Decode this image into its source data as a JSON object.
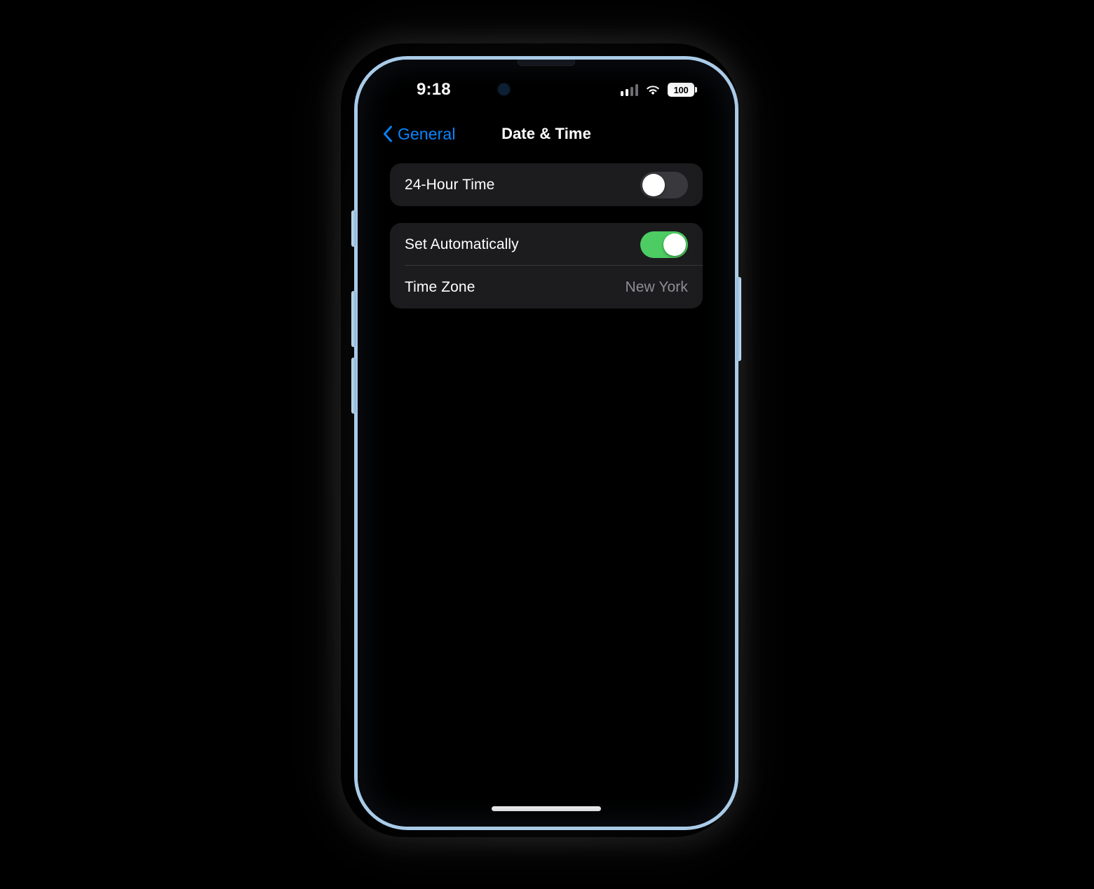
{
  "device": {
    "name": "iphone",
    "frame_color": "#a9cbe8",
    "buttons": [
      "action-button",
      "volume-up-button",
      "volume-down-button",
      "power-button"
    ]
  },
  "status_bar": {
    "time": "9:18",
    "signal_icon": "cellular-signal-icon",
    "signal_bars_active": 2,
    "signal_bars_total": 4,
    "wifi_icon": "wifi-icon",
    "battery_icon": "battery-icon",
    "battery_percent": "100"
  },
  "nav": {
    "back_icon": "chevron-left-icon",
    "back_label": "General",
    "title": "Date & Time",
    "accent_color": "#0a84ff"
  },
  "groups": [
    {
      "id": "time-format-group",
      "rows": [
        {
          "id": "24-hour-time",
          "label": "24-Hour Time",
          "control": "switch",
          "value": "off"
        }
      ]
    },
    {
      "id": "time-zone-group",
      "rows": [
        {
          "id": "set-automatically",
          "label": "Set Automatically",
          "control": "switch",
          "value": "on"
        },
        {
          "id": "time-zone",
          "label": "Time Zone",
          "control": "value",
          "value": "New York"
        }
      ]
    }
  ],
  "colors": {
    "screen_background": "#000000",
    "row_background": "#1c1c1e",
    "separator": "#38383a",
    "switch_on": "#4ccc62",
    "switch_off": "#39393d",
    "secondary_text": "#8e8e93",
    "primary_text": "#ffffff"
  },
  "home_indicator": "home-indicator"
}
